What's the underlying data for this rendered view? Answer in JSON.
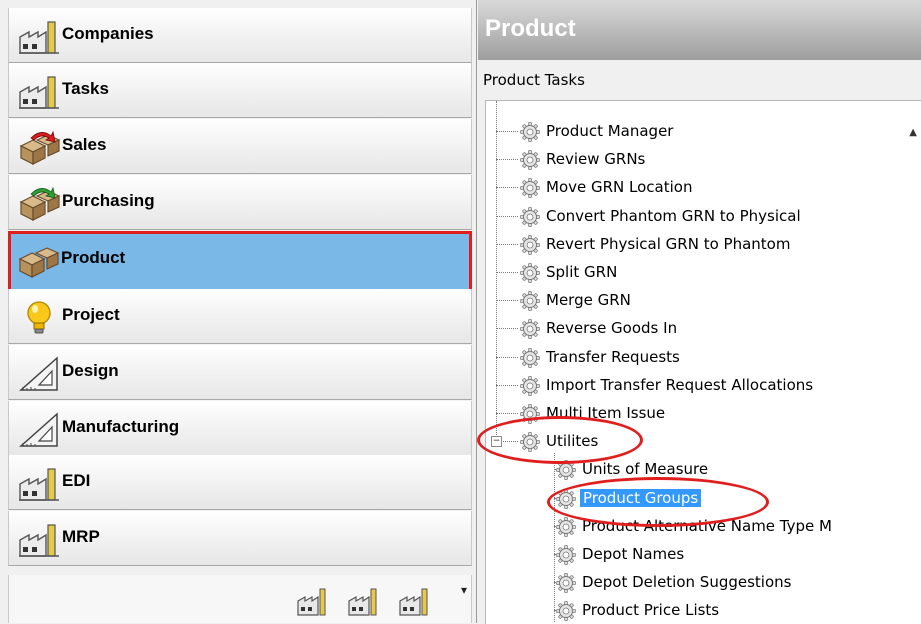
{
  "nav": {
    "items": [
      {
        "label": "Companies",
        "icon": "factory-icon"
      },
      {
        "label": "Tasks",
        "icon": "factory-icon"
      },
      {
        "label": "Sales",
        "icon": "boxes-red-arrow-icon"
      },
      {
        "label": "Purchasing",
        "icon": "boxes-green-arrow-icon"
      },
      {
        "label": "Product",
        "icon": "boxes-icon",
        "selected": true
      },
      {
        "label": "Project",
        "icon": "lightbulb-icon"
      },
      {
        "label": "Design",
        "icon": "set-square-icon"
      },
      {
        "label": "Manufacturing",
        "icon": "set-square-icon"
      },
      {
        "label": "EDI",
        "icon": "factory-icon"
      },
      {
        "label": "MRP",
        "icon": "factory-icon"
      }
    ],
    "footer_icons": [
      "factory-icon",
      "factory-icon",
      "factory-icon"
    ],
    "overflow_icon": "chevron-down-icon"
  },
  "pane": {
    "title": "Product",
    "subtitle": "Product Tasks"
  },
  "tree": {
    "items": [
      {
        "label": "Product Manager",
        "level": 0
      },
      {
        "label": "Review GRNs",
        "level": 0
      },
      {
        "label": "Move GRN Location",
        "level": 0
      },
      {
        "label": "Convert Phantom GRN to Physical",
        "level": 0
      },
      {
        "label": "Revert Physical GRN to Phantom",
        "level": 0
      },
      {
        "label": "Split GRN",
        "level": 0
      },
      {
        "label": "Merge GRN",
        "level": 0
      },
      {
        "label": "Reverse Goods In",
        "level": 0
      },
      {
        "label": "Transfer Requests",
        "level": 0
      },
      {
        "label": "Import Transfer Request Allocations",
        "level": 0
      },
      {
        "label": "Multi Item Issue",
        "level": 0
      },
      {
        "label": "Utilites",
        "level": 0,
        "expanded": true
      },
      {
        "label": "Units of Measure",
        "level": 1
      },
      {
        "label": "Product Groups",
        "level": 1,
        "selected": true
      },
      {
        "label": "Product Alternative Name Type M",
        "level": 1
      },
      {
        "label": "Depot Names",
        "level": 1
      },
      {
        "label": "Depot Deletion Suggestions",
        "level": 1
      },
      {
        "label": "Product Price Lists",
        "level": 1
      }
    ],
    "expander_symbol": "−"
  },
  "colors": {
    "selection_blue": "#3399ff",
    "nav_selected": "#7ab8e8",
    "annotation_red": "#e01e1e"
  }
}
